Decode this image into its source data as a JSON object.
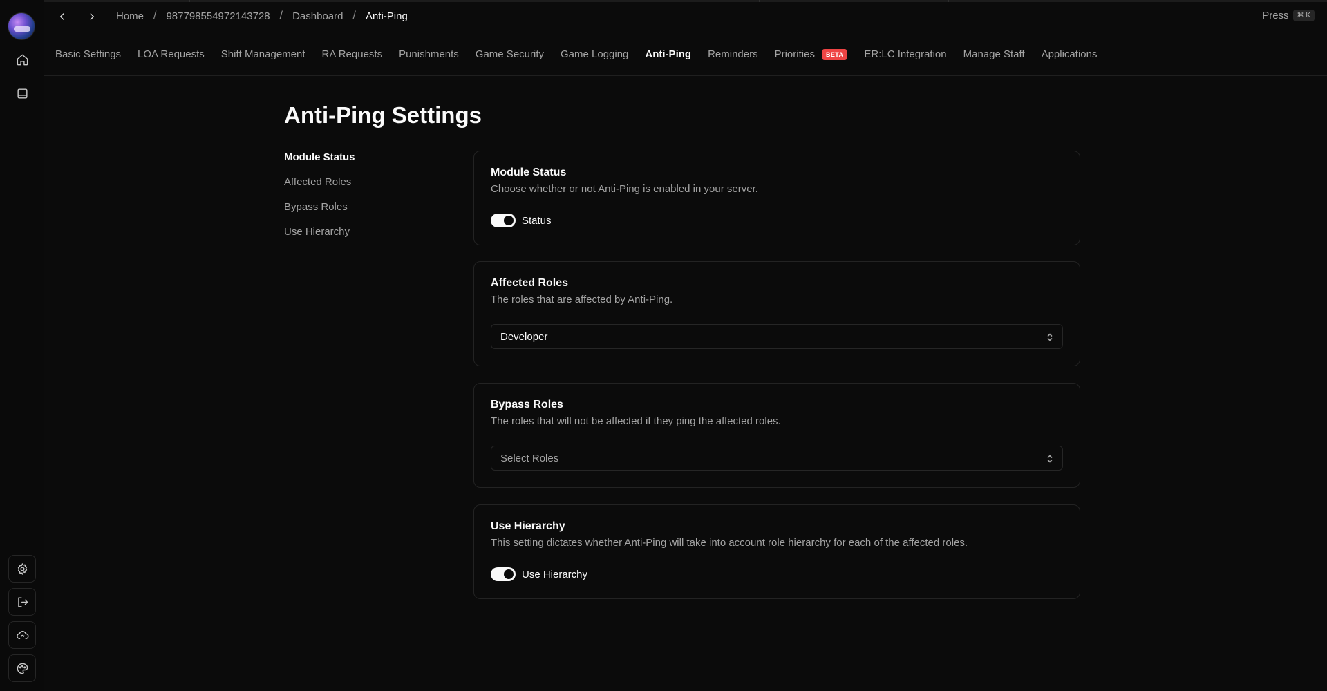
{
  "breadcrumb": {
    "items": [
      "Home",
      "987798554972143728",
      "Dashboard"
    ],
    "current": "Anti-Ping"
  },
  "command": {
    "press_label": "Press",
    "shortcut": "⌘ K"
  },
  "tabs": [
    {
      "label": "Basic Settings"
    },
    {
      "label": "LOA Requests"
    },
    {
      "label": "Shift Management"
    },
    {
      "label": "RA Requests"
    },
    {
      "label": "Punishments"
    },
    {
      "label": "Game Security"
    },
    {
      "label": "Game Logging"
    },
    {
      "label": "Anti-Ping",
      "active": true
    },
    {
      "label": "Reminders"
    },
    {
      "label": "Priorities",
      "badge": "BETA"
    },
    {
      "label": "ER:LC Integration"
    },
    {
      "label": "Manage Staff"
    },
    {
      "label": "Applications"
    }
  ],
  "page": {
    "title": "Anti-Ping Settings"
  },
  "side_nav": [
    "Module Status",
    "Affected Roles",
    "Bypass Roles",
    "Use Hierarchy"
  ],
  "sections": {
    "module_status": {
      "title": "Module Status",
      "description": "Choose whether or not Anti-Ping is enabled in your server.",
      "toggle_label": "Status",
      "enabled": true
    },
    "affected_roles": {
      "title": "Affected Roles",
      "description": "The roles that are affected by Anti-Ping.",
      "value": "Developer"
    },
    "bypass_roles": {
      "title": "Bypass Roles",
      "description": "The roles that will not be affected if they ping the affected roles.",
      "placeholder": "Select Roles"
    },
    "use_hierarchy": {
      "title": "Use Hierarchy",
      "description": "This setting dictates whether Anti-Ping will take into account role hierarchy for each of the affected roles.",
      "toggle_label": "Use Hierarchy",
      "enabled": true
    }
  },
  "rail_icons": [
    "home-icon",
    "panel-icon",
    "gear-icon",
    "logout-icon",
    "cloud-sync-icon",
    "palette-icon"
  ],
  "colors": {
    "background": "#0b0b0b",
    "accent": "#fafafa",
    "beta_badge": "#ef4444",
    "muted_text": "#a3a3a3",
    "border": "#232323"
  }
}
